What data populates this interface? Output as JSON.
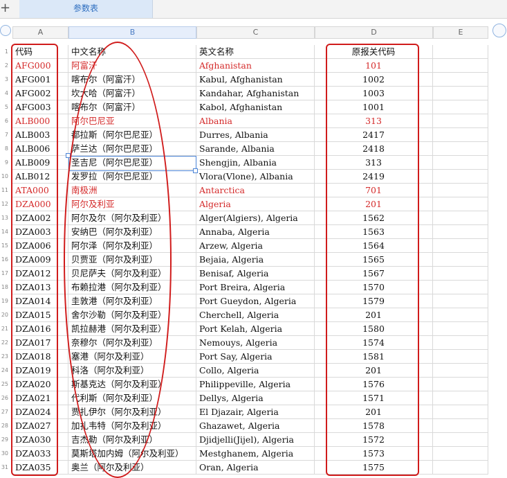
{
  "toolbar": {
    "add_sheet_symbol": "+",
    "sheet_tab": "参数表"
  },
  "columns": [
    "A",
    "B",
    "C",
    "D",
    "E"
  ],
  "selected_column": "B",
  "header_row": {
    "num": "1",
    "code": "代码",
    "cn": "中文名称",
    "en": "英文名称",
    "orig": "原报关代码"
  },
  "rows": [
    {
      "num": "2",
      "code": "AFG000",
      "cn": "阿富汗",
      "en": "Afghanistan",
      "orig": "101",
      "red": true
    },
    {
      "num": "3",
      "code": "AFG001",
      "cn": "喀布尔（阿富汗）",
      "en": "Kabul, Afghanistan",
      "orig": "1002",
      "red": false
    },
    {
      "num": "4",
      "code": "AFG002",
      "cn": "坎大哈（阿富汗）",
      "en": "Kandahar, Afghanistan",
      "orig": "1003",
      "red": false
    },
    {
      "num": "5",
      "code": "AFG003",
      "cn": "喀布尔（阿富汗）",
      "en": "Kabol, Afghanistan",
      "orig": "1001",
      "red": false
    },
    {
      "num": "6",
      "code": "ALB000",
      "cn": "阿尔巴尼亚",
      "en": "Albania",
      "orig": "313",
      "red": true
    },
    {
      "num": "7",
      "code": "ALB003",
      "cn": "都拉斯（阿尔巴尼亚）",
      "en": "Durres, Albania",
      "orig": "2417",
      "red": false
    },
    {
      "num": "8",
      "code": "ALB006",
      "cn": "萨兰达（阿尔巴尼亚）",
      "en": "Sarande, Albania",
      "orig": "2418",
      "red": false
    },
    {
      "num": "9",
      "code": "ALB009",
      "cn": "圣吉尼（阿尔巴尼亚）",
      "en": "Shengjin, Albania",
      "orig": "313",
      "red": false
    },
    {
      "num": "10",
      "code": "ALB012",
      "cn": "发罗拉（阿尔巴尼亚）",
      "en": "Vlora(Vlone), Albania",
      "orig": "2419",
      "red": false
    },
    {
      "num": "11",
      "code": "ATA000",
      "cn": "南极洲",
      "en": "Antarctica",
      "orig": "701",
      "red": true
    },
    {
      "num": "12",
      "code": "DZA000",
      "cn": "阿尔及利亚",
      "en": "Algeria",
      "orig": "201",
      "red": true
    },
    {
      "num": "13",
      "code": "DZA002",
      "cn": "阿尔及尔（阿尔及利亚）",
      "en": "Alger(Algiers), Algeria",
      "orig": "1562",
      "red": false
    },
    {
      "num": "14",
      "code": "DZA003",
      "cn": "安纳巴（阿尔及利亚）",
      "en": "Annaba, Algeria",
      "orig": "1563",
      "red": false
    },
    {
      "num": "15",
      "code": "DZA006",
      "cn": "阿尔泽（阿尔及利亚）",
      "en": "Arzew, Algeria",
      "orig": "1564",
      "red": false
    },
    {
      "num": "16",
      "code": "DZA009",
      "cn": "贝贾亚（阿尔及利亚）",
      "en": "Bejaia, Algeria",
      "orig": "1565",
      "red": false
    },
    {
      "num": "17",
      "code": "DZA012",
      "cn": "贝尼萨夫（阿尔及利亚）",
      "en": "Benisaf, Algeria",
      "orig": "1567",
      "red": false
    },
    {
      "num": "18",
      "code": "DZA013",
      "cn": "布赖拉港（阿尔及利亚）",
      "en": "Port Breira, Algeria",
      "orig": "1570",
      "red": false
    },
    {
      "num": "19",
      "code": "DZA014",
      "cn": "圭敦港（阿尔及利亚）",
      "en": "Port Gueydon, Algeria",
      "orig": "1579",
      "red": false
    },
    {
      "num": "20",
      "code": "DZA015",
      "cn": "舍尔沙勒（阿尔及利亚）",
      "en": "Cherchell, Algeria",
      "orig": "201",
      "red": false
    },
    {
      "num": "21",
      "code": "DZA016",
      "cn": "凯拉赫港（阿尔及利亚）",
      "en": "Port Kelah, Algeria",
      "orig": "1580",
      "red": false
    },
    {
      "num": "22",
      "code": "DZA017",
      "cn": "奈穆尔（阿尔及利亚）",
      "en": "Nemouys, Algeria",
      "orig": "1574",
      "red": false
    },
    {
      "num": "23",
      "code": "DZA018",
      "cn": "塞港（阿尔及利亚）",
      "en": "Port Say, Algeria",
      "orig": "1581",
      "red": false
    },
    {
      "num": "24",
      "code": "DZA019",
      "cn": "科洛（阿尔及利亚）",
      "en": "Collo, Algeria",
      "orig": "201",
      "red": false
    },
    {
      "num": "25",
      "code": "DZA020",
      "cn": "斯基克达（阿尔及利亚）",
      "en": "Philippeville, Algeria",
      "orig": "1576",
      "red": false
    },
    {
      "num": "26",
      "code": "DZA021",
      "cn": "代利斯（阿尔及利亚）",
      "en": "Dellys, Algeria",
      "orig": "1571",
      "red": false
    },
    {
      "num": "27",
      "code": "DZA024",
      "cn": "贾扎伊尔（阿尔及利亚）",
      "en": "El Djazair, Algeria",
      "orig": "201",
      "red": false
    },
    {
      "num": "28",
      "code": "DZA027",
      "cn": "加扎韦特（阿尔及利亚）",
      "en": "Ghazawet, Algeria",
      "orig": "1578",
      "red": false
    },
    {
      "num": "29",
      "code": "DZA030",
      "cn": "吉杰勒（阿尔及利亚）",
      "en": "Djidjelli(Jijel), Algeria",
      "orig": "1572",
      "red": false
    },
    {
      "num": "30",
      "code": "DZA033",
      "cn": "莫斯塔加内姆（阿尔及利亚）",
      "en": "Mestghanem, Algeria",
      "orig": "1573",
      "red": false
    },
    {
      "num": "31",
      "code": "DZA035",
      "cn": "奥兰（阿尔及利亚）",
      "en": "Oran, Algeria",
      "orig": "1575",
      "red": false
    }
  ],
  "colors": {
    "red_text": "#d42a2a",
    "annotation": "#d01b1b",
    "selection": "#4a83d6"
  }
}
